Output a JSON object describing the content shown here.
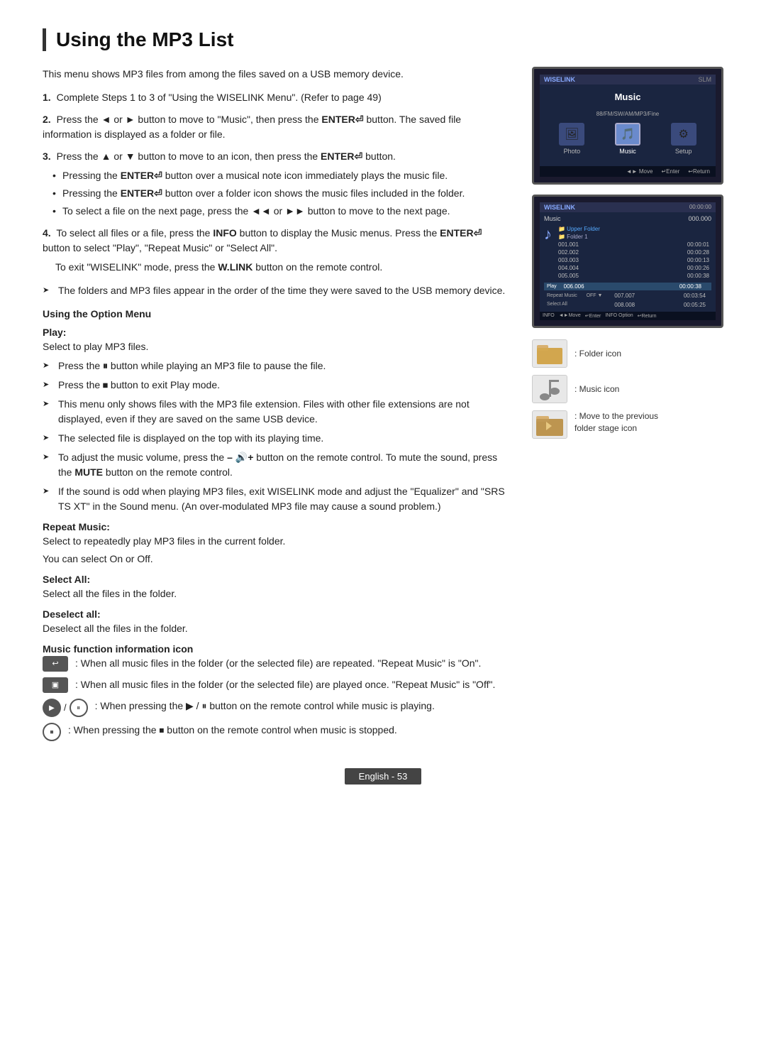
{
  "page": {
    "title": "Using the MP3 List",
    "footer": "English - 53"
  },
  "intro": {
    "text": "This menu shows MP3 files from among the files saved on a USB memory device."
  },
  "steps": [
    {
      "num": "1.",
      "text": "Complete Steps 1 to 3 of \"Using the WISELINK Menu\". (Refer to page 49)"
    },
    {
      "num": "2.",
      "text": "Press the ◄ or ► button to move to \"Music\", then press the ",
      "bold": "ENTER",
      "bold_suffix": "⏎",
      "rest": " button. The saved file information is displayed as a folder or file.",
      "bullets": []
    },
    {
      "num": "3.",
      "text": "Press the ▲ or ▼ button to move to an icon, then press the ",
      "bold": "ENTER",
      "bold_suffix": "⏎",
      "rest": " button.",
      "bullets": [
        "Pressing the ENTER⏎ button over a musical note icon immediately plays the music file.",
        "Pressing the ENTER⏎ button over a folder icon shows the music files included in the folder.",
        "To select a file on the next page, press the ◄◄ or ►► button to move to the next page."
      ]
    },
    {
      "num": "4.",
      "text": "To select all files or a file, press the INFO button to display the Music menus. Press the ENTER⏎ button to select \"Play\", \"Repeat Music\" or \"Select All\".",
      "sub_text": "To exit \"WISELINK\" mode, press the W.LINK button on the remote control."
    }
  ],
  "arrows": [
    "The folders and MP3 files appear in the order of the time they were saved to the USB memory device."
  ],
  "option_menu": {
    "heading": "Using the Option Menu",
    "play": {
      "heading": "Play:",
      "text": "Select to play MP3 files.",
      "arrows": [
        "Press the ⏸ button while playing an MP3 file to pause the file.",
        "Press the ⏹ button to exit Play mode.",
        "This menu only shows files with the MP3 file extension. Files with other file extensions are not displayed, even if they are saved on the same USB device.",
        "The selected file is displayed on the top with its playing time.",
        "To adjust the music volume, press the – 🔊+ button on the remote control. To mute the sound, press the MUTE button on the remote control.",
        "If the sound is odd when playing MP3 files, exit WISELINK mode and adjust the \"Equalizer\" and \"SRS TS XT\" in the Sound menu. (An over-modulated MP3 file may cause a sound problem.)"
      ]
    },
    "repeat_music": {
      "heading": "Repeat Music:",
      "text": "Select to repeatedly play MP3 files in the current folder.",
      "text2": "You can select On or Off."
    },
    "select_all": {
      "heading": "Select All:",
      "text": "Select all the files in the folder."
    },
    "deselect_all": {
      "heading": "Deselect all:",
      "text": "Deselect all the files in the folder."
    }
  },
  "music_func_icons": {
    "heading": "Music function information icon",
    "items": [
      {
        "icon_type": "box",
        "icon_label": "↩",
        "text": ": When all music files in the folder (or the selected file) are repeated. \"Repeat Music\" is \"On\"."
      },
      {
        "icon_type": "box",
        "icon_label": "⬜",
        "text": ": When all music files in the folder (or the selected file) are played once. \"Repeat Music\" is \"Off\"."
      },
      {
        "icon_type": "circle_play",
        "icon_label": "▶ / ⏸",
        "text": ": When pressing the ▶ / ⏸ button on the remote control while music is playing."
      },
      {
        "icon_type": "circle_stop",
        "icon_label": "⏹",
        "text": ": When pressing the ⏹ button on the remote control when music is stopped."
      }
    ]
  },
  "right_panel": {
    "screen1": {
      "brand": "WISELINK",
      "model": "SLM",
      "title": "Music",
      "icons": [
        {
          "label": "Photo",
          "glyph": "🖼"
        },
        {
          "label": "Music",
          "glyph": "🎵"
        },
        {
          "label": "Setup",
          "glyph": "⚙"
        }
      ],
      "nav": "◄► Move  ↵Enter  ↩Return"
    },
    "screen2": {
      "brand": "WISELINK",
      "title": "Music",
      "header_left": "000.000",
      "header_right": "00:00:00",
      "folder": "Upper Folder",
      "sub_folder": "Folder 1",
      "files": [
        {
          "name": "001.001",
          "time": "00:00:01"
        },
        {
          "name": "002.002",
          "time": "00:00:28"
        },
        {
          "name": "003.003",
          "time": "00:00:13"
        },
        {
          "name": "004.004",
          "time": "00:00:26"
        },
        {
          "name": "005.005",
          "time": "00:00:38"
        },
        {
          "name": "006.006",
          "time": "00:00:38"
        },
        {
          "name": "007.007",
          "time": "00:03:54"
        },
        {
          "name": "008.008",
          "time": "00:05:25"
        }
      ],
      "controls_left": "INFO",
      "controls_right": "◄►Move ↵Enter INFO Option ↩Return"
    },
    "icons": [
      {
        "label": ": Folder icon",
        "glyph": "📁"
      },
      {
        "label": ": Music icon",
        "glyph": "🎵"
      },
      {
        "label": ": Move to the previous\n folder stage icon",
        "glyph": "📂"
      }
    ]
  }
}
